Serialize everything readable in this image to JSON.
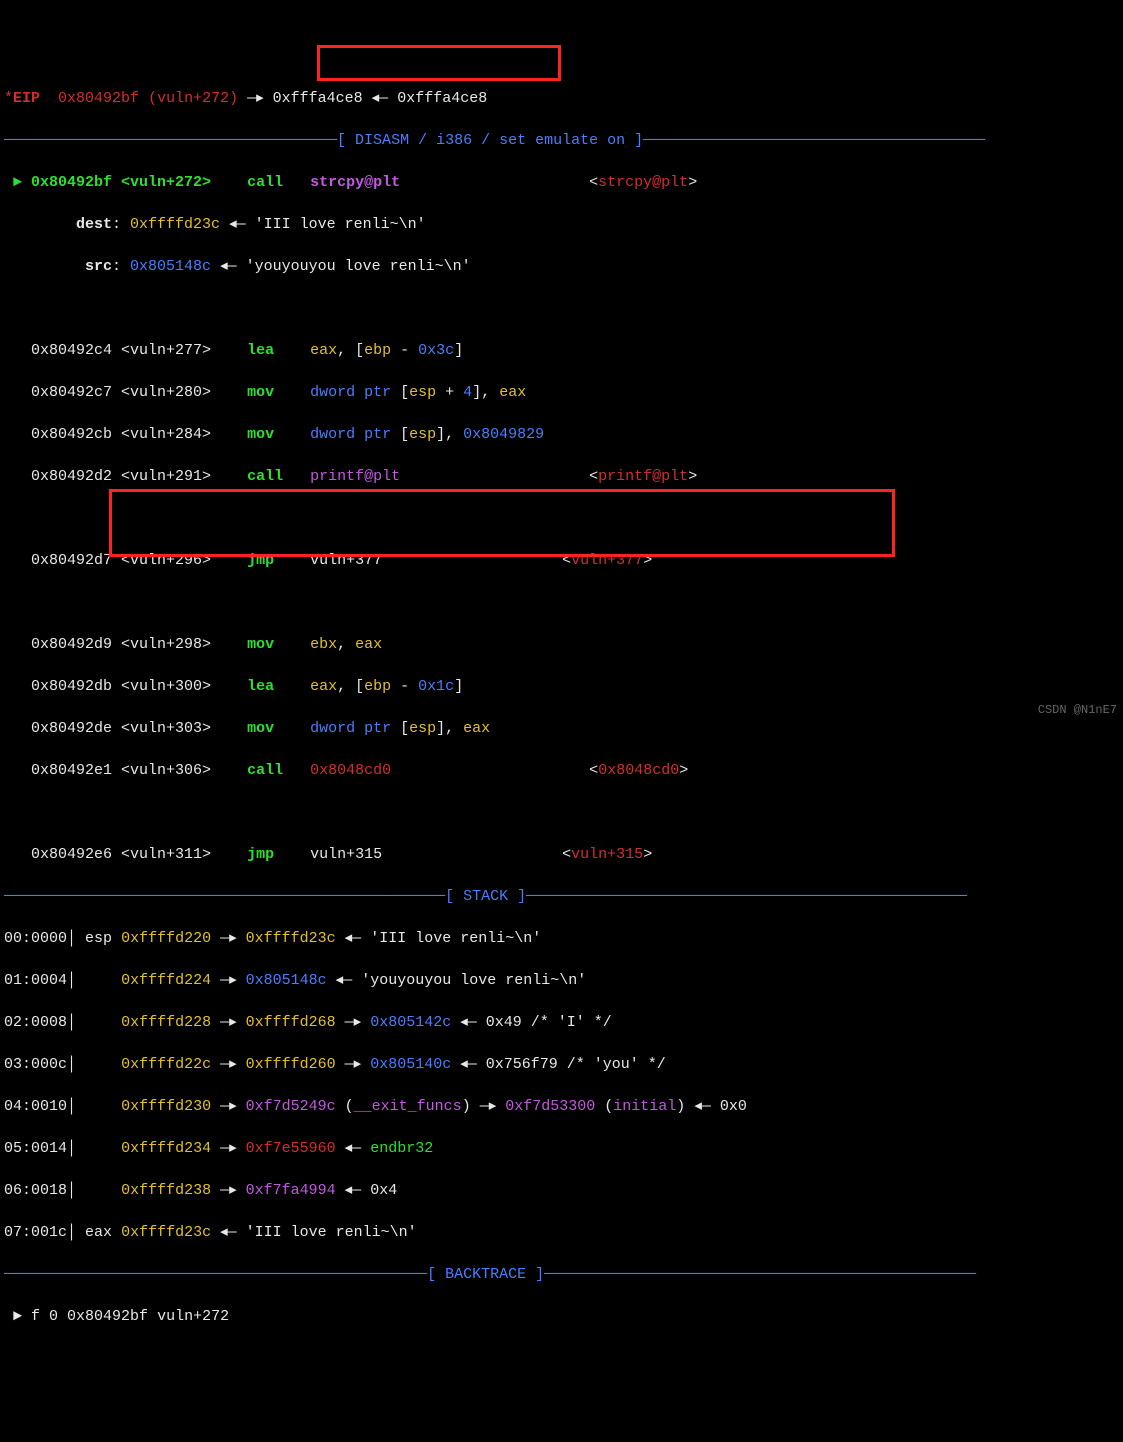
{
  "reg_header": {
    "star": "*",
    "reg": "EIP",
    "addr": "0x80492bf",
    "paren": "(vuln+272)",
    "arrow1": " —▸ ",
    "val1": "0xfffa4ce8",
    "arrow2": " ◂— ",
    "val2": "0xfffa4ce8"
  },
  "disasm_title": "─────────────────────────────────────[ DISASM / i386 / set emulate on ]──────────────────────────────────────",
  "arrow_current": " ► ",
  "lines": [
    {
      "addr": "0x80492bf",
      "sym": "<vuln+272>",
      "mnemonic": "call",
      "op": "strcpy@plt",
      "target": "<",
      "target_sym": "strcpy@plt",
      "target_end": ">"
    },
    {
      "indent": "        ",
      "label": "dest",
      "colon": ": ",
      "addr": "0xffffd23c",
      "arrow": " ◂— ",
      "val": "'III love renli~\\n'"
    },
    {
      "indent": "         ",
      "label": "src",
      "colon": ": ",
      "addr": "0x805148c",
      "arrow": " ◂— ",
      "val": "'youyouyou love renli~\\n'"
    }
  ],
  "instr": [
    {
      "addr": "0x80492c4",
      "sym": "<vuln+277>",
      "mn": "lea",
      "op_plain": "eax",
      "op_rest": ", [",
      "reg2": "ebp",
      "mid": " - ",
      "imm": "0x3c",
      "end": "]"
    },
    {
      "addr": "0x80492c7",
      "sym": "<vuln+280>",
      "mn": "mov",
      "op_kw": "dword ptr ",
      "br": "[",
      "reg2": "esp",
      "mid": " + ",
      "imm": "4",
      "end2": "], ",
      "reg3": "eax"
    },
    {
      "addr": "0x80492cb",
      "sym": "<vuln+284>",
      "mn": "mov",
      "op_kw": "dword ptr ",
      "br": "[",
      "reg2": "esp",
      "end3": "], ",
      "imm2": "0x8049829"
    },
    {
      "addr": "0x80492d2",
      "sym": "<vuln+291>",
      "mn": "call",
      "call_target": "printf@plt",
      "tbracket": "<",
      "tsym": "printf@plt",
      "tbend": ">"
    },
    {
      "blank": true
    },
    {
      "addr": "0x80492d7",
      "sym": "<vuln+296>",
      "mn": "jmp",
      "jmp_target": "vuln+377",
      "tbracket": "<",
      "tsym": "vuln+377",
      "tbend": ">"
    },
    {
      "blank": true
    },
    {
      "addr": "0x80492d9",
      "sym": "<vuln+298>",
      "mn": "mov",
      "reg4": "ebx",
      "comma": ", ",
      "reg5": "eax"
    },
    {
      "addr": "0x80492db",
      "sym": "<vuln+300>",
      "mn": "lea",
      "reg4": "eax",
      "rest2": ", [",
      "reg5a": "ebp",
      "mid2": " - ",
      "imm3": "0x1c",
      "end4": "]"
    },
    {
      "addr": "0x80492de",
      "sym": "<vuln+303>",
      "mn": "mov",
      "op_kw": "dword ptr ",
      "br": "[",
      "reg2": "esp",
      "end3": "], ",
      "reg6": "eax"
    },
    {
      "addr": "0x80492e1",
      "sym": "<vuln+306>",
      "mn": "call",
      "call_addr": "0x8048cd0",
      "tbracket": "<",
      "taddr": "0x8048cd0",
      "tbend": ">"
    },
    {
      "blank": true
    },
    {
      "addr": "0x80492e6",
      "sym": "<vuln+311>",
      "mn": "jmp",
      "jmp_target": "vuln+315",
      "tbracket": "<",
      "tsym": "vuln+315",
      "tbend": ">"
    }
  ],
  "stack_title": "─────────────────────────────────────────────────[ STACK ]─────────────────────────────────────────────────",
  "stack": [
    {
      "idx": "00:",
      "off": "0000",
      "bar": "│",
      "reg": " esp ",
      "addr": "0xffffd220",
      "a1": " —▸ ",
      "v1": "0xffffd23c",
      "a2": " ◂— ",
      "str": "'III love renli~\\n'"
    },
    {
      "idx": "01:",
      "off": "0004",
      "bar": "│",
      "pad": "     ",
      "addr": "0xffffd224",
      "a1": " —▸ ",
      "v1": "0x805148c",
      "a2": " ◂— ",
      "str": "'youyouyou love renli~\\n'"
    },
    {
      "idx": "02:",
      "off": "0008",
      "bar": "│",
      "pad": "     ",
      "addr": "0xffffd228",
      "a1": " —▸ ",
      "v1": "0xffffd268",
      "a2": " —▸ ",
      "v2": "0x805142c",
      "a3": " ◂— ",
      "hex": "0x49",
      "cmt": " /* 'I' */"
    },
    {
      "idx": "03:",
      "off": "000c",
      "bar": "│",
      "pad": "     ",
      "addr": "0xffffd22c",
      "a1": " —▸ ",
      "v1": "0xffffd260",
      "a2": " —▸ ",
      "v2": "0x805140c",
      "a3": " ◂— ",
      "hex": "0x756f79",
      "cmt": " /* 'you' */"
    },
    {
      "idx": "04:",
      "off": "0010",
      "bar": "│",
      "pad": "     ",
      "addr": "0xffffd230",
      "a1": " —▸ ",
      "v1m": "0xf7d5249c",
      "sym": " (",
      "symname": "__exit_funcs",
      "symend": ")",
      "a2": " —▸ ",
      "v2m": "0xf7d53300",
      "sym2": " (",
      "symname2": "initial",
      "symend2": ")",
      "a3": " ◂— ",
      "hex": "0x0"
    },
    {
      "idx": "05:",
      "off": "0014",
      "bar": "│",
      "pad": "     ",
      "addr": "0xffffd234",
      "a1": " —▸ ",
      "v1r": "0xf7e55960",
      "a2": " ◂— ",
      "inst": "endbr32"
    },
    {
      "idx": "06:",
      "off": "0018",
      "bar": "│",
      "pad": "     ",
      "addr": "0xffffd238",
      "a1": " —▸ ",
      "v1m": "0xf7fa4994",
      "a2": " ◂— ",
      "hex": "0x4"
    },
    {
      "idx": "07:",
      "off": "001c",
      "bar": "│",
      "reg": " eax ",
      "addr": "0xffffd23c",
      "a2": " ◂— ",
      "str": "'III love renli~\\n'"
    }
  ],
  "backtrace_title": "───────────────────────────────────────────────[ BACKTRACE ]────────────────────────────────────────────────",
  "backtrace": {
    "marker": " ► ",
    "frame": "f 0",
    "addr": "0x80492bf",
    "sym": "vuln+272"
  },
  "watermark": "CSDN @N1nE7"
}
